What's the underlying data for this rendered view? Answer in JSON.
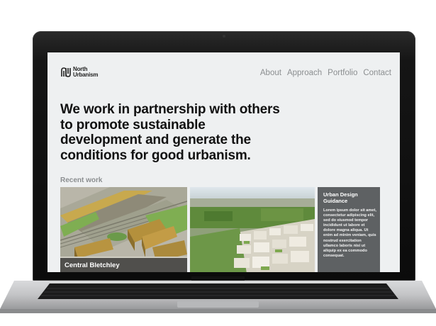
{
  "site": {
    "logo_text": "North\nUrbanism",
    "nav": [
      "About",
      "Approach",
      "Portfolio",
      "Contact"
    ],
    "headline": "We work in partnership with others to promote sustainable development and generate the conditions for good urbanism.",
    "recent_label": "Recent work",
    "tiles": [
      {
        "caption": "Central Bletchley"
      },
      {
        "caption": ""
      },
      {
        "title": "Urban Design Guidance",
        "body": "Lorem ipsum dolor sit amet, consectetur adipiscing elit, sed do eiusmod tempor incididunt ut labore et dolore magna aliqua. Ut enim ad minim veniam, quis nostrud exercitation ullamco laboris nisi ut aliquip ex ea commodo consequat."
      }
    ]
  },
  "colors": {
    "screen_bg": "#eef0f1",
    "nav_text": "#8b8e90",
    "headline": "#111111",
    "panel_bg": "#5e6163"
  }
}
